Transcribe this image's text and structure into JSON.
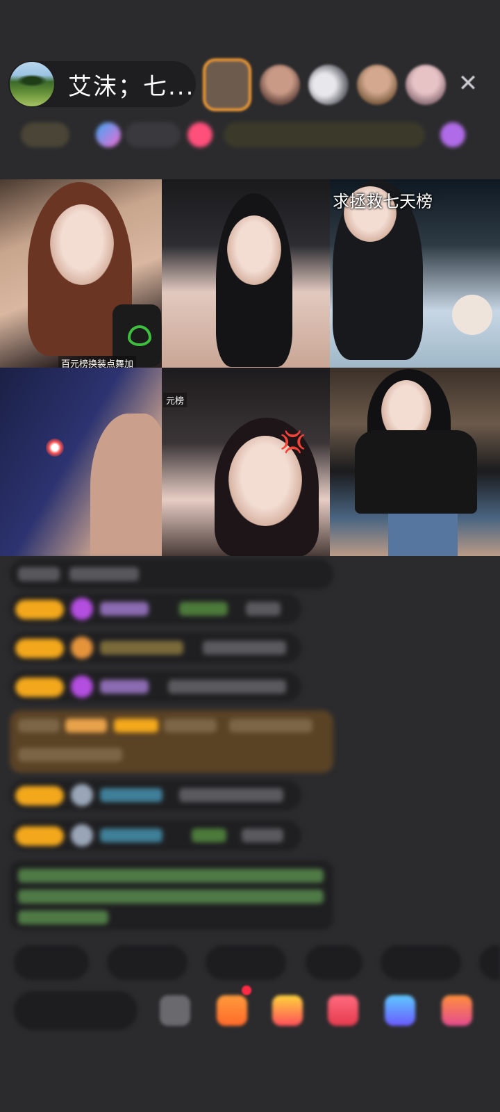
{
  "host": {
    "name": "艾沫；七..."
  },
  "header": {
    "close_symbol": "✕"
  },
  "streams": [
    {
      "id": 1,
      "label": "百元榜换装点舞加"
    },
    {
      "id": 2,
      "label": ""
    },
    {
      "id": 3,
      "title": "求拯救七天榜"
    },
    {
      "id": 4,
      "label": ""
    },
    {
      "id": 5,
      "label": "元榜"
    },
    {
      "id": 6,
      "label": ""
    }
  ],
  "colors": {
    "background": "#2b2b2d",
    "badge": "#f3a81c",
    "top_viewer_frame": "#f19a33",
    "notification_dot": "#ff2b44"
  },
  "icons": {
    "close": "close-icon",
    "comment_emoji": "emoji-icon",
    "gift": "gift-icon"
  }
}
